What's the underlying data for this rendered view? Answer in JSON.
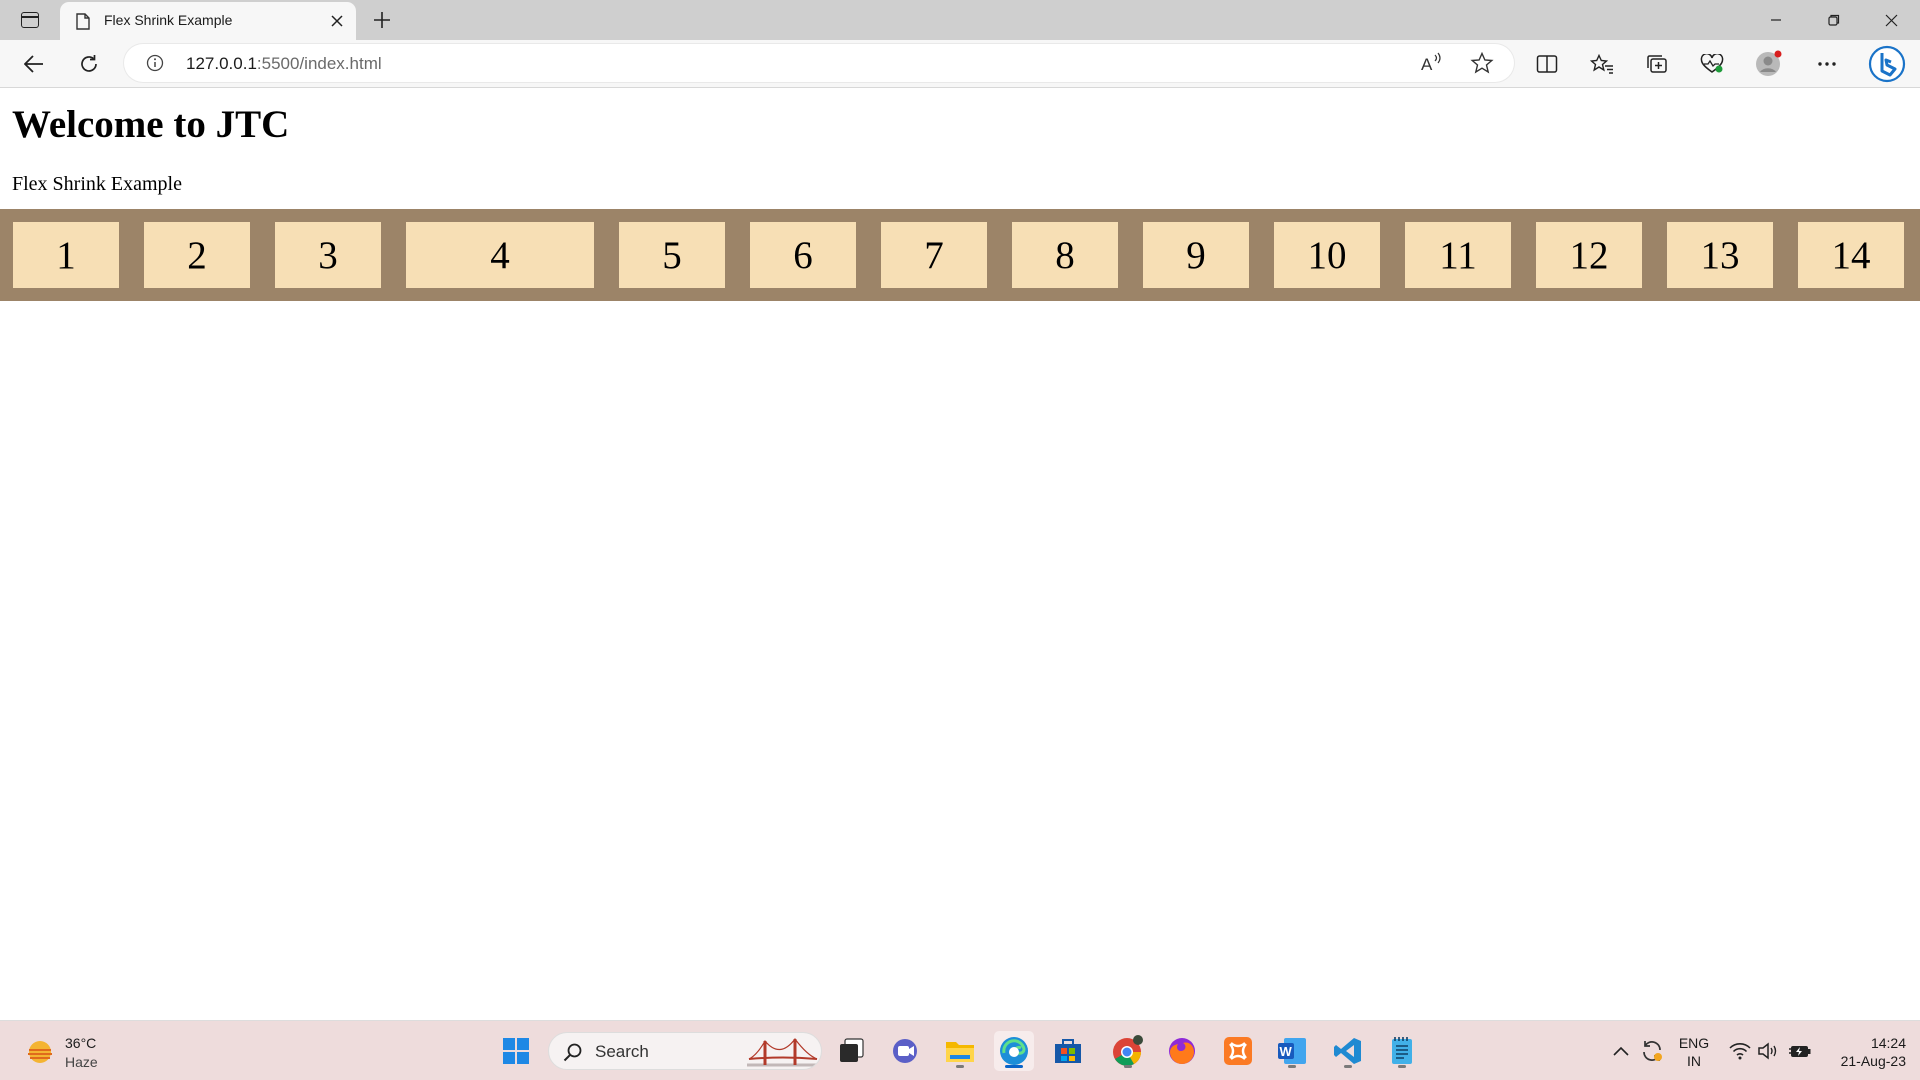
{
  "browser": {
    "tab_title": "Flex Shrink Example",
    "url_host": "127.0.0.1",
    "url_rest": ":5500/index.html"
  },
  "page": {
    "heading": "Welcome to JTC",
    "subtitle": "Flex Shrink Example",
    "boxes": [
      {
        "label": "1",
        "width": 106
      },
      {
        "label": "2",
        "width": 106
      },
      {
        "label": "3",
        "width": 106
      },
      {
        "label": "4",
        "width": 188
      },
      {
        "label": "5",
        "width": 106
      },
      {
        "label": "6",
        "width": 106
      },
      {
        "label": "7",
        "width": 106
      },
      {
        "label": "8",
        "width": 106
      },
      {
        "label": "9",
        "width": 106
      },
      {
        "label": "10",
        "width": 106
      },
      {
        "label": "11",
        "width": 106
      },
      {
        "label": "12",
        "width": 106
      },
      {
        "label": "13",
        "width": 106
      },
      {
        "label": "14",
        "width": 106
      }
    ],
    "colors": {
      "container": "#9c8468",
      "box": "#f7dfb5"
    }
  },
  "taskbar": {
    "weather_temp": "36°C",
    "weather_condition": "Haze",
    "search_label": "Search",
    "lang_top": "ENG",
    "lang_bottom": "IN",
    "time": "14:24",
    "date": "21-Aug-23"
  }
}
